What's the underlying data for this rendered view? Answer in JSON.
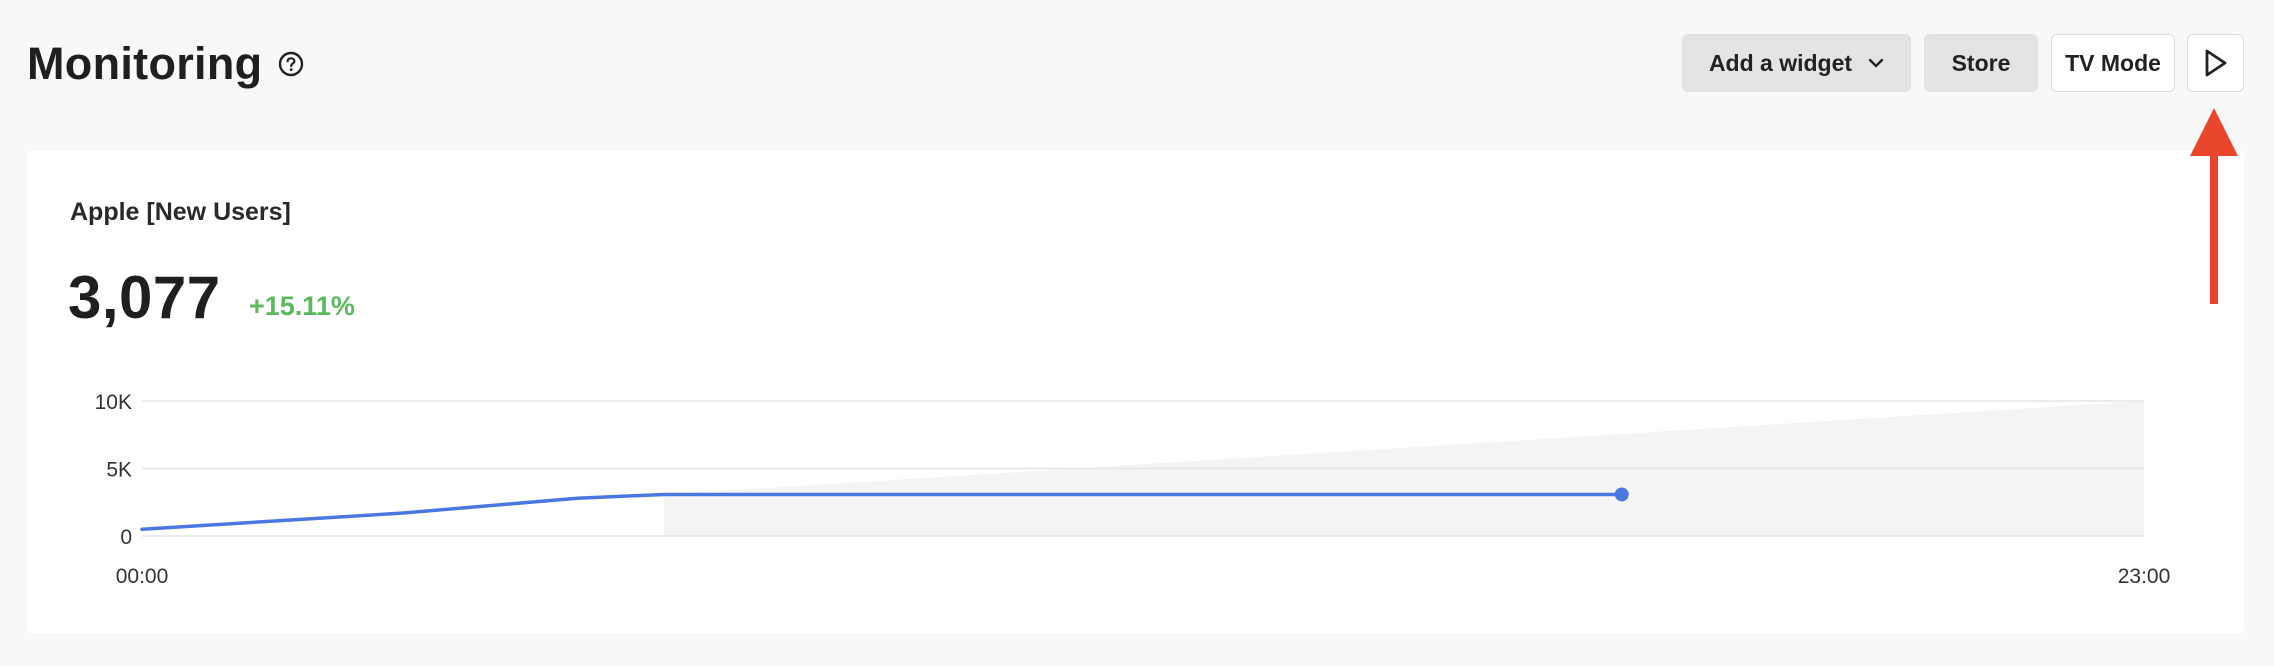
{
  "header": {
    "title": "Monitoring",
    "help_icon": "question-circle-icon",
    "buttons": {
      "add_widget": "Add a widget",
      "store": "Store",
      "tv_mode": "TV Mode",
      "play_icon": "play-icon"
    }
  },
  "widget": {
    "title": "Apple [New Users]",
    "value": "3,077",
    "delta": "+15.11%",
    "delta_color": "#5cb85c"
  },
  "colors": {
    "line": "#4a78e0",
    "annotation_arrow": "#e8452c"
  },
  "chart_data": {
    "type": "line",
    "title": "",
    "xlabel": "",
    "ylabel": "",
    "x_tick_labels": [
      "00:00",
      "23:00"
    ],
    "y_tick_labels": [
      "10K",
      "5K",
      "0"
    ],
    "ylim": [
      0,
      10000
    ],
    "xlim": [
      0,
      23
    ],
    "grid": true,
    "series": [
      {
        "x": [
          0,
          3,
          5,
          6,
          10,
          17
        ],
        "values": [
          500,
          1700,
          2800,
          3077,
          3077,
          3077
        ]
      }
    ],
    "projection": {
      "x": [
        6,
        23
      ],
      "values": [
        3077,
        10000
      ]
    }
  }
}
